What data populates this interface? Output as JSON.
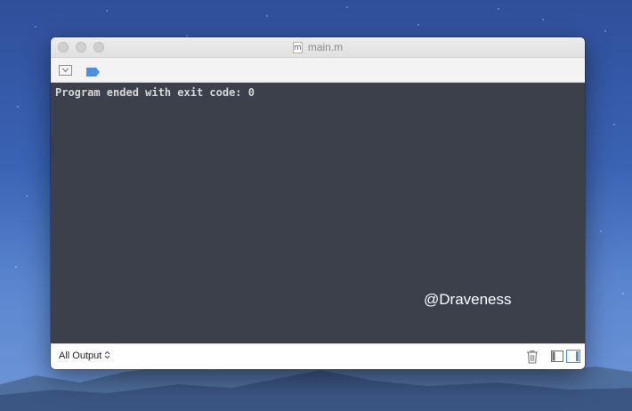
{
  "window": {
    "title": "main.m",
    "file_type_glyph": "m"
  },
  "toolbar": {
    "icons": [
      "hide-debug-area-icon",
      "breakpoint-icon"
    ]
  },
  "console": {
    "output": "Program ended with exit code: 0",
    "watermark": "@Draveness"
  },
  "bottombar": {
    "output_filter": "All Output",
    "icons": [
      "trash-icon",
      "variables-view-icon",
      "console-view-icon"
    ]
  },
  "colors": {
    "console_bg": "#3b404b",
    "console_text": "#d7d7d7",
    "accent": "#4a90e2"
  }
}
